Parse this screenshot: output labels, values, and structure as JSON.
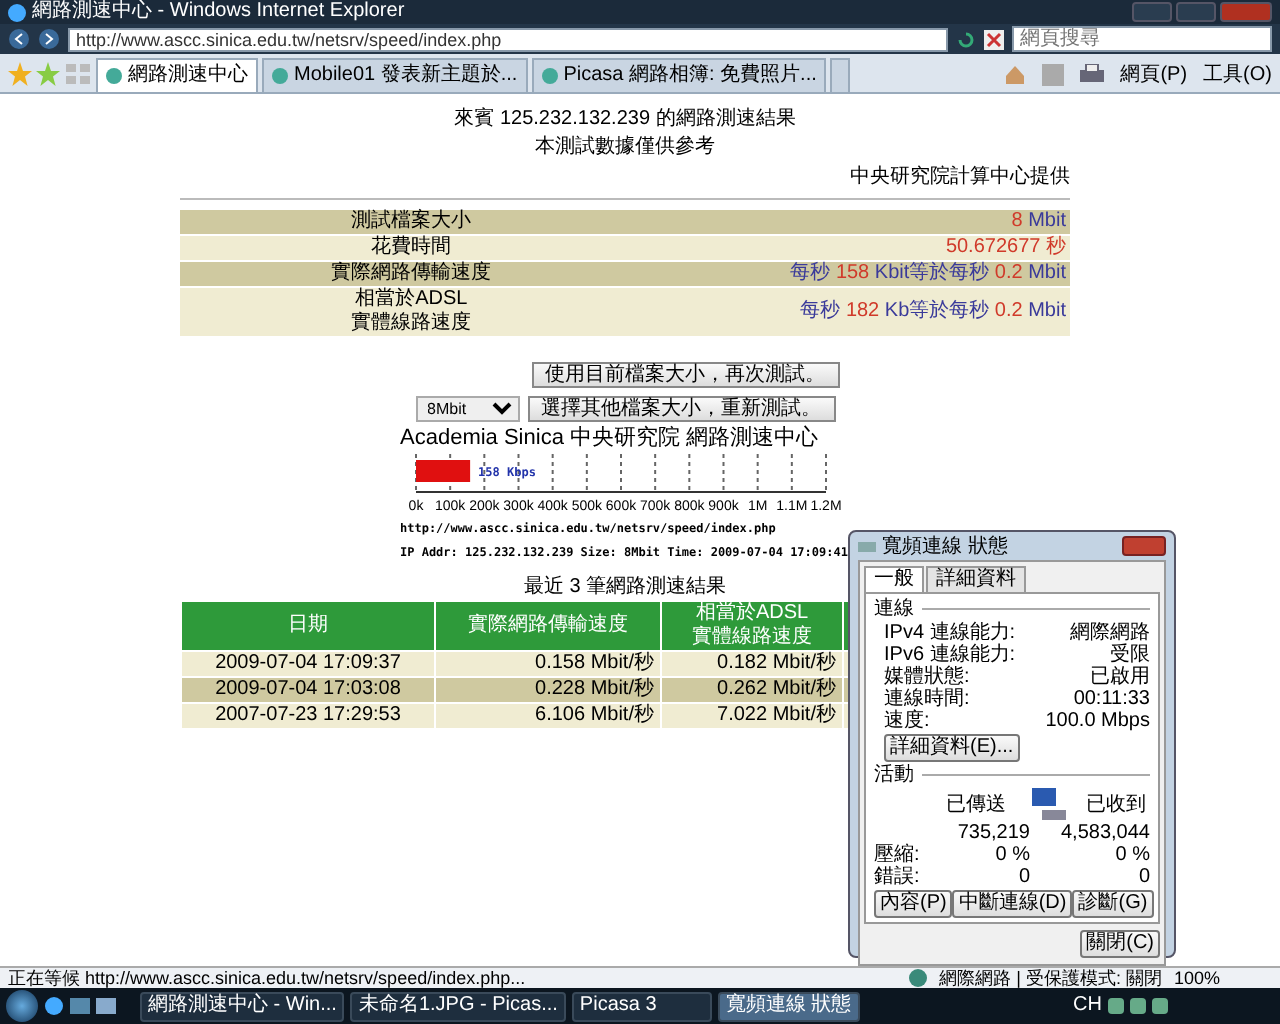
{
  "window": {
    "title": "網路測速中心 - Windows Internet Explorer"
  },
  "address_bar": {
    "url": "http://www.ascc.sinica.edu.tw/netsrv/speed/index.php"
  },
  "search": {
    "placeholder": "網頁搜尋"
  },
  "tabs": [
    {
      "label": "網路測速中心",
      "selected": true
    },
    {
      "label": "Mobile01 發表新主題於...",
      "selected": false
    },
    {
      "label": "Picasa 網路相簿: 免費照片...",
      "selected": false
    }
  ],
  "command_bar": [
    "網頁(P)",
    "工具(O)"
  ],
  "page": {
    "heading": [
      "來賓 125.232.132.239 的網路測速結果",
      "本測試數據僅供參考"
    ],
    "credit": "中央研究院計算中心提供",
    "result_rows": [
      {
        "label": "測試檔案大小",
        "value": [
          {
            "kind": "number",
            "text": "8"
          },
          {
            "kind": "unit",
            "text": " Mbit"
          }
        ]
      },
      {
        "label": "花費時間",
        "value": [
          {
            "kind": "number",
            "text": "50.672677 秒"
          }
        ]
      },
      {
        "label": "實際網路傳輸速度",
        "value": [
          {
            "kind": "unit",
            "text": "每秒 "
          },
          {
            "kind": "number",
            "text": "158"
          },
          {
            "kind": "unit",
            "text": " Kbit等於每秒 "
          },
          {
            "kind": "number",
            "text": "0.2"
          },
          {
            "kind": "unit",
            "text": " Mbit"
          }
        ]
      },
      {
        "label": "相當於ADSL\n實體線路速度",
        "value": [
          {
            "kind": "unit",
            "text": "每秒 "
          },
          {
            "kind": "number",
            "text": "182"
          },
          {
            "kind": "unit",
            "text": " Kb等於每秒 "
          },
          {
            "kind": "number",
            "text": "0.2"
          },
          {
            "kind": "unit",
            "text": " Mbit"
          }
        ]
      }
    ],
    "retest_button": "使用目前檔案大小，再次測試。",
    "size_select": {
      "value": "8Mbit"
    },
    "change_button": "選擇其他檔案大小，重新測試。",
    "speed_graph": {
      "title": "Academia Sinica 中央研究院 網路測速中心",
      "level": 0.132,
      "reading": "158 Kbps",
      "scale_labels": [
        "0k",
        "100k",
        "200k",
        "300k",
        "400k",
        "500k",
        "600k",
        "700k",
        "800k",
        "900k",
        "1M",
        "1.1M",
        "1.2M"
      ]
    },
    "graph_url": "http://www.ascc.sinica.edu.tw/netsrv/speed/index.php",
    "graph_info": "IP Addr: 125.232.132.239 Size: 8Mbit Time: 2009-07-04 17:09:41",
    "history": {
      "title": "最近 3 筆網路測速結果",
      "columns": [
        "日期",
        "實際網路傳輸速度",
        "相當於ADSL\n實體線路速度"
      ],
      "rows": [
        [
          "2009-07-04 17:09:37",
          "0.158 Mbit/秒",
          "0.182 Mbit/秒"
        ],
        [
          "2009-07-04 17:03:08",
          "0.228 Mbit/秒",
          "0.262 Mbit/秒"
        ],
        [
          "2007-07-23 17:29:53",
          "6.106 Mbit/秒",
          "7.022 Mbit/秒"
        ]
      ]
    }
  },
  "status_dialog": {
    "title": "寬頻連線 狀態",
    "tabs": [
      {
        "label": "一般",
        "selected": true
      },
      {
        "label": "詳細資料",
        "selected": false
      }
    ],
    "connection_title": "連線",
    "connection_rows": [
      {
        "label": "IPv4 連線能力:",
        "value": "網際網路"
      },
      {
        "label": "IPv6 連線能力:",
        "value": "受限"
      },
      {
        "label": "媒體狀態:",
        "value": "已啟用"
      },
      {
        "label": "連線時間:",
        "value": "00:11:33"
      },
      {
        "label": "速度:",
        "value": "100.0 Mbps"
      }
    ],
    "details_button": "詳細資料(E)...",
    "activity_title": "活動",
    "sent_label": "已傳送",
    "received_label": "已收到",
    "activity_rows": [
      {
        "label": "",
        "sent": "735,219",
        "received": "4,583,044"
      },
      {
        "label": "壓縮:",
        "sent": "0 %",
        "received": "0 %"
      },
      {
        "label": "錯誤:",
        "sent": "0",
        "received": "0"
      }
    ],
    "buttons": [
      "內容(P)",
      "中斷連線(D)",
      "診斷(G)"
    ],
    "close_button": "關閉(C)"
  },
  "status_bar": {
    "text": "正在等候 http://www.ascc.sinica.edu.tw/netsrv/speed/index.php...",
    "zone": "網際網路 | 受保護模式: 關閉",
    "zoom": "100%"
  },
  "taskbar": {
    "items": [
      {
        "label": "網路測速中心 - Win...",
        "selected": false
      },
      {
        "label": "未命名1.JPG - Picas...",
        "selected": false
      },
      {
        "label": "Picasa 3",
        "selected": false
      },
      {
        "label": "寬頻連線 狀態",
        "selected": true
      }
    ],
    "language": "CH"
  }
}
